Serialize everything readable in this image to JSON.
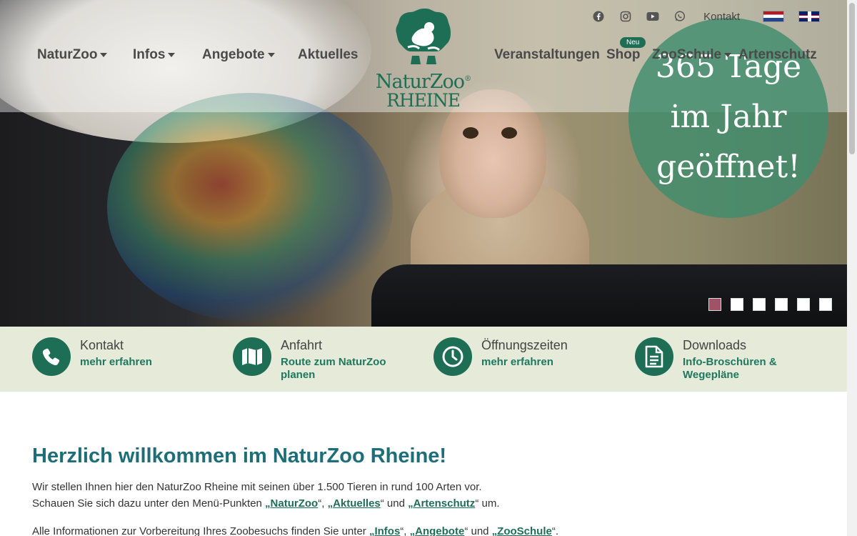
{
  "topbar": {
    "social": [
      "facebook-icon",
      "instagram-icon",
      "youtube-icon",
      "whatsapp-icon"
    ],
    "kontakt": "Kontakt",
    "flags": [
      "netherlands-flag",
      "uk-flag"
    ]
  },
  "nav": {
    "naturzoo": "NaturZoo",
    "infos": "Infos",
    "angebote": "Angebote",
    "aktuelles": "Aktuelles",
    "veranstaltungen": "Veranstaltungen",
    "shop": "Shop",
    "shop_badge": "Neu",
    "zooschule": "ZooSchule",
    "artenschutz": "Artenschutz"
  },
  "logo": {
    "line1": "NaturZoo",
    "line2": "RHEINE",
    "mark": "®"
  },
  "hero": {
    "badge_line1": "365 Tage",
    "badge_line2": "im Jahr",
    "badge_line3": "geöffnet!",
    "slides": 6,
    "active_slide": 1
  },
  "quick_links": [
    {
      "icon": "phone-icon",
      "title": "Kontakt",
      "link": "mehr erfahren"
    },
    {
      "icon": "map-icon",
      "title": "Anfahrt",
      "link_line1": "Route zum NaturZoo",
      "link_line2": "planen"
    },
    {
      "icon": "clock-icon",
      "title": "Öffnungszeiten",
      "link": "mehr erfahren"
    },
    {
      "icon": "document-icon",
      "title": "Downloads",
      "link_line1": "Info-Broschüren &",
      "link_line2": "Wegepläne"
    }
  ],
  "content": {
    "heading": "Herzlich willkommen im NaturZoo Rheine!",
    "p1_line1": "Wir stellen Ihnen hier den NaturZoo Rheine mit seinen über 1.500 Tieren in rund 100 Arten vor.",
    "p1_pre": "Schauen Sie sich dazu unter den Menü-Punkten ",
    "p1_link1": "„NaturZoo",
    "p1_sep1": "“, ",
    "p1_link2": "„Aktuelles",
    "p1_sep2": "“ und ",
    "p1_link3": "„Artenschutz",
    "p1_post": "“ um.",
    "p2_pre": "Alle Informationen zur Vorbereitung Ihres Zoobesuchs finden Sie unter ",
    "p2_link1": "„Infos",
    "p2_sep1": "“, ",
    "p2_link2": "„Angebote",
    "p2_sep2": "“ und ",
    "p2_link3": "„ZooSchule",
    "p2_post": "“."
  },
  "colors": {
    "brand_green": "#1e6e55",
    "heading_teal": "#1e6e7a",
    "band_bg": "#e5ead9",
    "active_dot": "#a05266"
  }
}
